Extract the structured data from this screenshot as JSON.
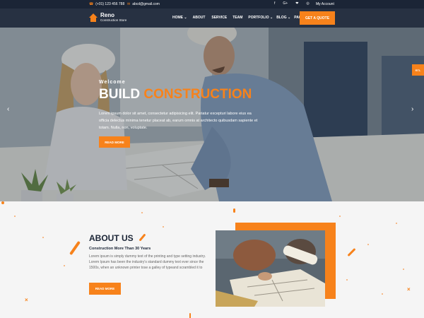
{
  "topbar": {
    "phone": "(+01) 123 456 788",
    "email": "abcd@gmail.com",
    "socials": [
      "f",
      "G+",
      "❤",
      "◎",
      "∴"
    ],
    "account": "My Account"
  },
  "header": {
    "logo_title": "Reno",
    "logo_subtitle": "Construction Store",
    "nav": [
      {
        "label": "HOME",
        "dropdown": true
      },
      {
        "label": "ABOUT",
        "dropdown": false
      },
      {
        "label": "SERVICE",
        "dropdown": false
      },
      {
        "label": "TEAM",
        "dropdown": false
      },
      {
        "label": "PORTFOLIO",
        "dropdown": true
      },
      {
        "label": "BLOG",
        "dropdown": true
      },
      {
        "label": "PAGE",
        "dropdown": true
      }
    ],
    "cta": "GET A QUOTE"
  },
  "hero": {
    "welcome": "Welcome",
    "title_white": "BUILD",
    "title_accent": "CONSTRUCTION",
    "text": "Lorem ipsum dolor sit amet, consectetur adipisicing elit. Pariatur excepturi labore eius ea officia delectus minima tenetur placeat ab, earum omnis at architecto quibusdam sapiente et totam. Nulla, non, voluptate.",
    "button": "READ MORE",
    "prev_arrow": "‹",
    "next_arrow": "›",
    "rtl": "RTL"
  },
  "about": {
    "title": "ABOUT US",
    "subtitle": "Construction More Than 30 Years",
    "text": "Lorem ipsum is simply dummy text of the printing and type setting industry. Lorem Ipsum has been the industry's standard dummy text ever since the 1500s, when an unknown printer tose a galley of typeand scrambled it to",
    "button": "READ MORE"
  },
  "colors": {
    "accent": "#f7821b",
    "dark": "#1b2536"
  },
  "icons": {
    "phone": "phone-icon",
    "email": "envelope-icon",
    "logo": "house-logo-icon",
    "arrow_left": "chevron-left-icon",
    "arrow_right": "chevron-right-icon"
  }
}
